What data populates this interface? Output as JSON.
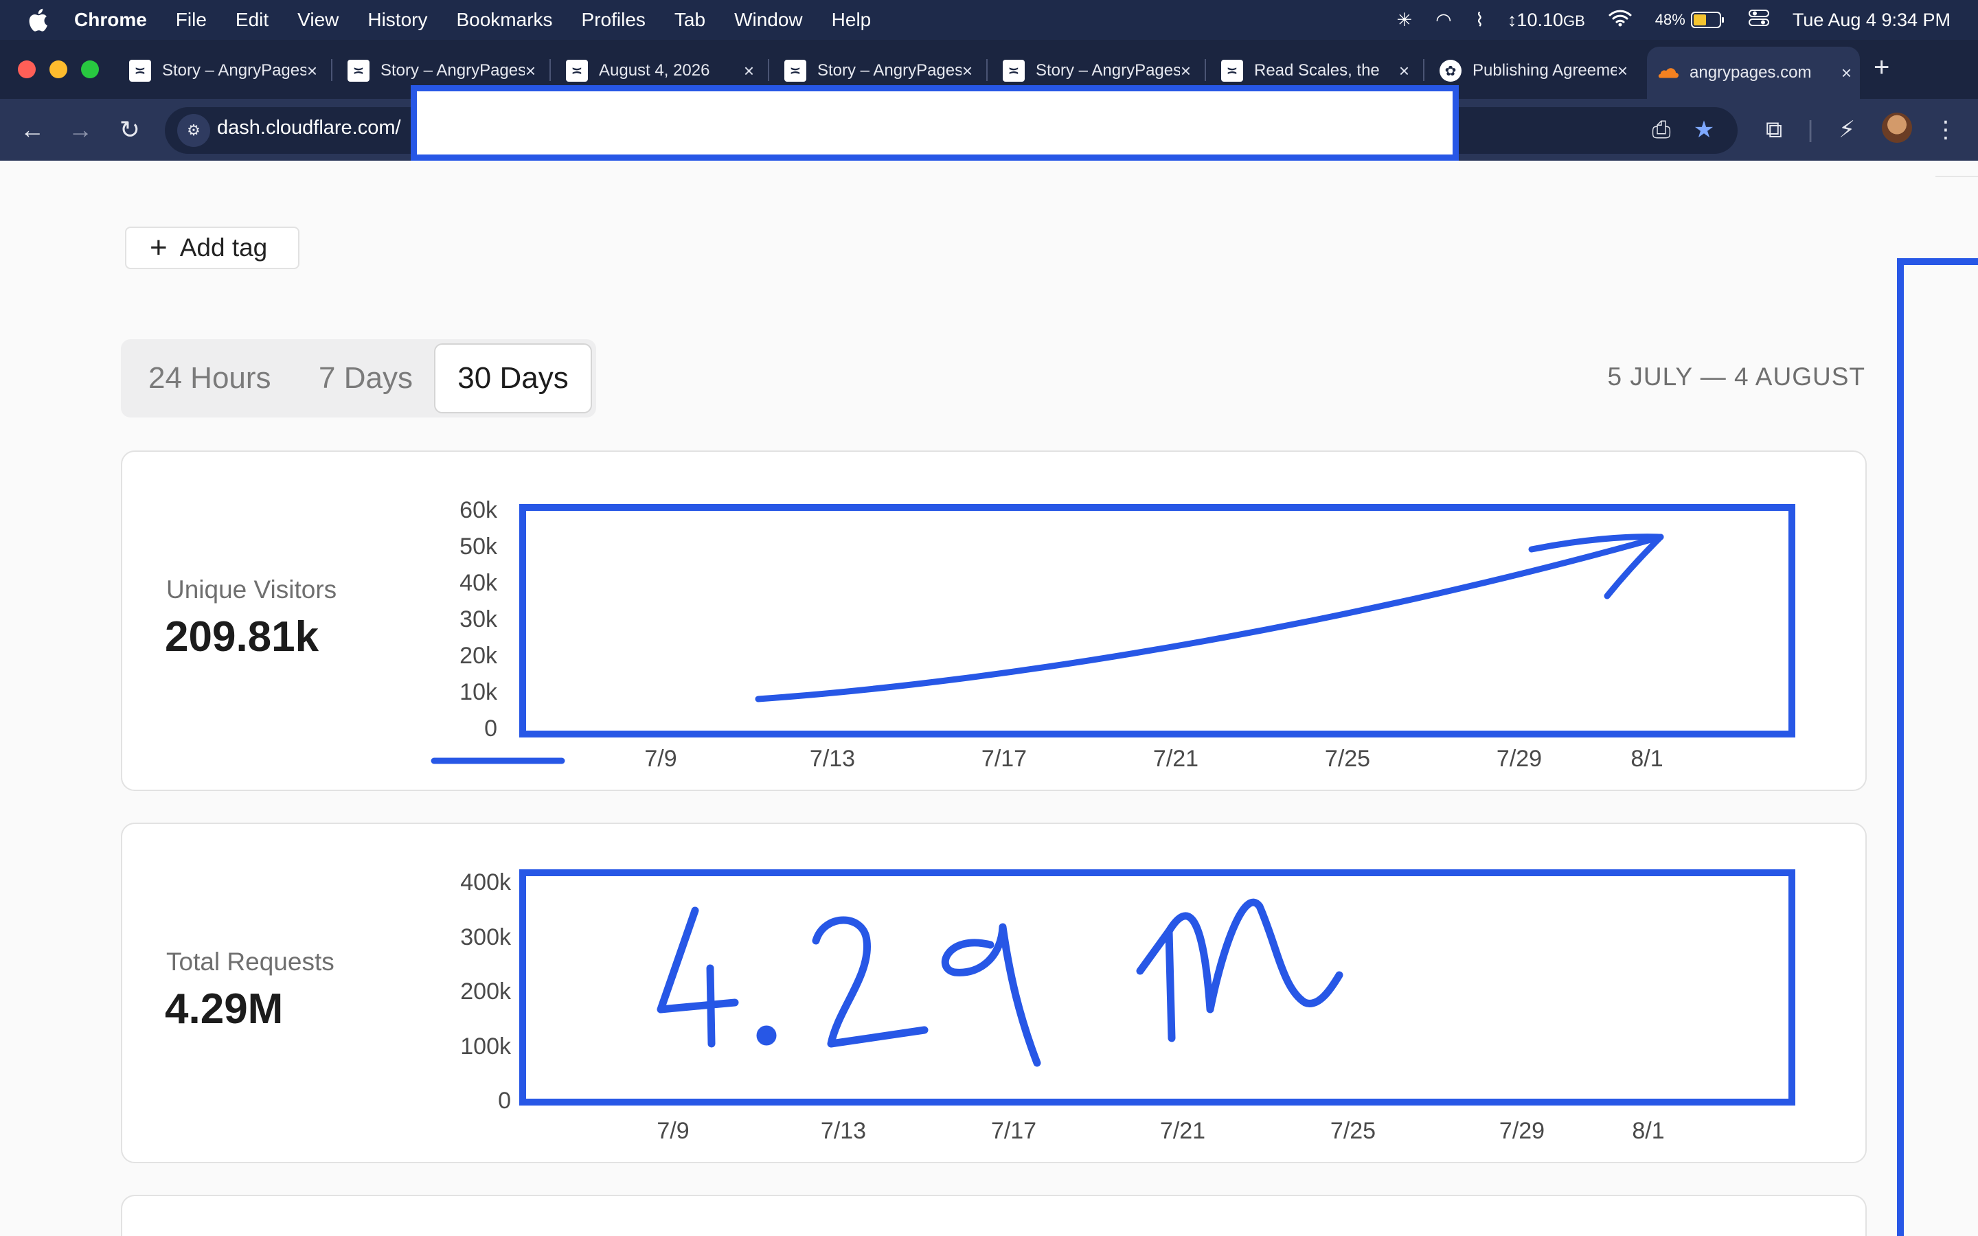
{
  "menubar": {
    "app_name": "Chrome",
    "items": [
      "File",
      "Edit",
      "View",
      "History",
      "Bookmarks",
      "Profiles",
      "Tab",
      "Window",
      "Help"
    ],
    "memory": "10.10",
    "memory_unit": "GB",
    "battery": "48%",
    "datetime": "Tue Aug 4  9:34 PM"
  },
  "tabs": [
    {
      "title": "Story – AngryPages"
    },
    {
      "title": "Story – AngryPages"
    },
    {
      "title": "August 4, 2026"
    },
    {
      "title": "Story – AngryPages"
    },
    {
      "title": "Story – AngryPages"
    },
    {
      "title": "Read Scales, the"
    },
    {
      "title": "Publishing Agreement"
    },
    {
      "title": "angrypages.com"
    }
  ],
  "toolbar": {
    "url": "dash.cloudflare.com/"
  },
  "page": {
    "add_tag_label": "Add tag",
    "ranges": [
      "24 Hours",
      "7 Days",
      "30 Days"
    ],
    "active_range": "30 Days",
    "date_range": "5 JULY — 4 AUGUST"
  },
  "metrics": {
    "visitors": {
      "label": "Unique Visitors",
      "value": "209.81k"
    },
    "requests": {
      "label": "Total Requests",
      "value": "4.29M"
    }
  },
  "annotation_color": "#2757e6",
  "chart_data": [
    {
      "type": "line",
      "title": "Unique Visitors",
      "yticks": [
        "60k",
        "50k",
        "40k",
        "30k",
        "20k",
        "10k",
        "0"
      ],
      "xticks": [
        "7/9",
        "7/13",
        "7/17",
        "7/21",
        "7/25",
        "7/29",
        "8/1"
      ],
      "ylim": [
        0,
        60000
      ],
      "grid": false
    },
    {
      "type": "line",
      "title": "Total Requests",
      "yticks": [
        "400k",
        "300k",
        "200k",
        "100k",
        "0"
      ],
      "xticks": [
        "7/9",
        "7/13",
        "7/17",
        "7/21",
        "7/25",
        "7/29",
        "8/1"
      ],
      "ylim": [
        0,
        400000
      ],
      "grid": false
    }
  ]
}
